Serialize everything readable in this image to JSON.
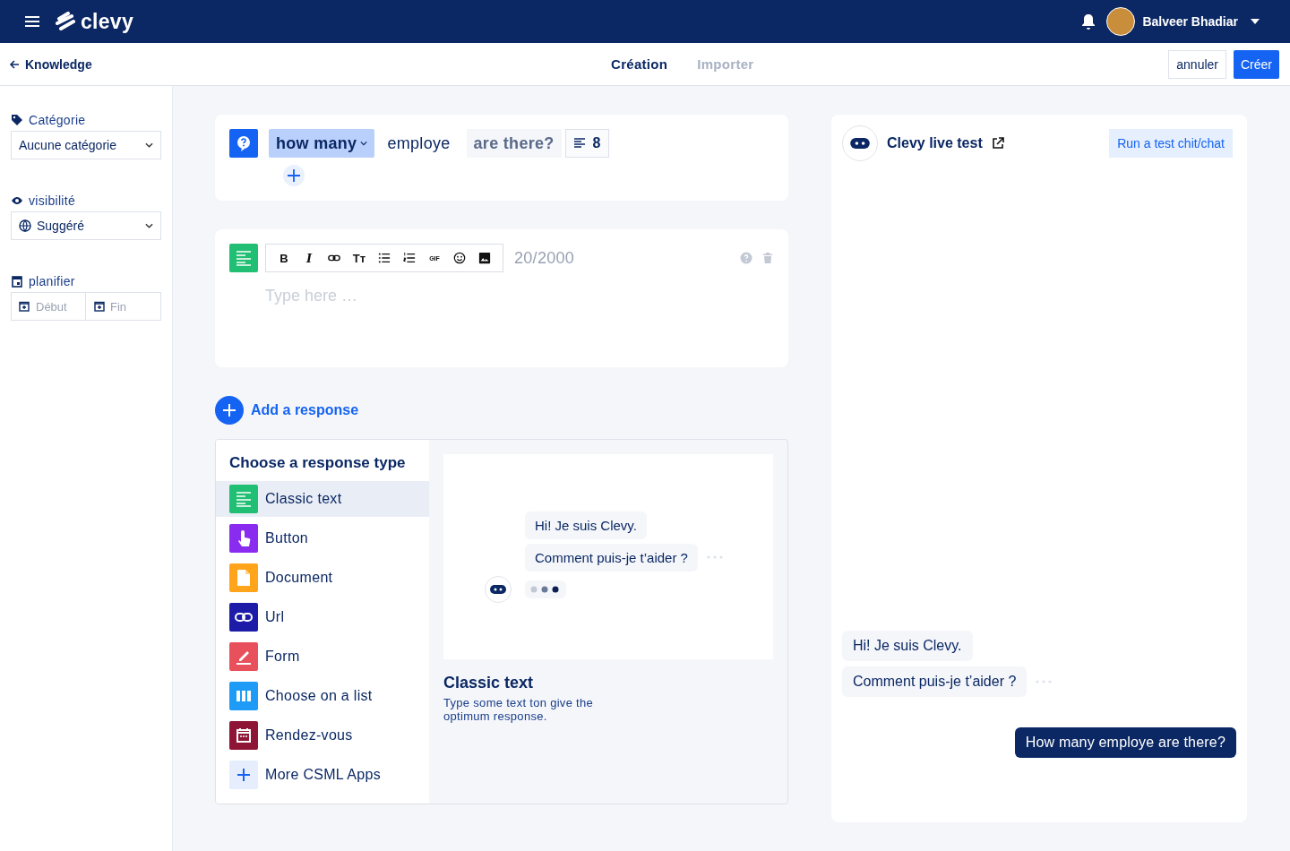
{
  "header": {
    "logo_text": "clevy",
    "user_name": "Balveer Bhadiar"
  },
  "subbar": {
    "back_link": "Knowledge",
    "tabs": [
      {
        "label": "Création",
        "selected": true
      },
      {
        "label": "Importer",
        "selected": false
      }
    ],
    "cancel_button": "annuler",
    "create_button": "Créer"
  },
  "sidebar": {
    "category": {
      "label": "Catégorie",
      "value": "Aucune catégorie"
    },
    "visibility": {
      "label": "visibilité",
      "value": "Suggéré"
    },
    "schedule": {
      "label": "planifier",
      "start_placeholder": "Début",
      "end_placeholder": "Fin"
    }
  },
  "question": {
    "tokens": [
      {
        "kind": "entity",
        "text": "how many"
      },
      {
        "kind": "word",
        "text": "employe"
      },
      {
        "kind": "variable",
        "text": "are there?"
      }
    ],
    "count": "8"
  },
  "editor": {
    "toolbar": [
      {
        "kind": "text",
        "label": "B"
      },
      {
        "kind": "italic",
        "label": "I"
      },
      {
        "kind": "link"
      },
      {
        "kind": "text",
        "label": "Tт"
      },
      {
        "kind": "bullets"
      },
      {
        "kind": "numbers"
      },
      {
        "kind": "small",
        "label": "GIF"
      },
      {
        "kind": "emoji"
      },
      {
        "kind": "image"
      }
    ],
    "counter": "20/2000",
    "placeholder": "Type here …"
  },
  "add_response": "Add a response",
  "chooser": {
    "title": "Choose a response type",
    "types": [
      {
        "kind": "text",
        "label": "Classic text",
        "color": "#21bf73",
        "selected": true
      },
      {
        "kind": "touch",
        "label": "Button",
        "color": "#8a2cf0",
        "selected": false
      },
      {
        "kind": "document",
        "label": "Document",
        "color": "#ffa41b",
        "selected": false
      },
      {
        "kind": "link",
        "label": "Url",
        "color": "#1c1ca8",
        "selected": false
      },
      {
        "kind": "pen",
        "label": "Form",
        "color": "#e8505b",
        "selected": false
      },
      {
        "kind": "columns",
        "label": "Choose on a list",
        "color": "#1e9bf7",
        "selected": false
      },
      {
        "kind": "calendar",
        "label": "Rendez-vous",
        "color": "#8e1535",
        "selected": false
      },
      {
        "kind": "plus",
        "label": "More CSML Apps",
        "color": "#e6edfd",
        "selected": false
      }
    ],
    "preview": {
      "messages": [
        "Hi! Je suis Clevy.",
        "Comment puis-je t’aider ?"
      ],
      "title": "Classic text",
      "description": "Type some text ton give the optimum response."
    }
  },
  "live_test": {
    "title": "Clevy live test",
    "run_button": "Run a test chit/chat",
    "bot_messages": [
      "Hi! Je suis Clevy.",
      "Comment puis-je t’aider ?"
    ],
    "user_message": "How many employe are there?"
  }
}
